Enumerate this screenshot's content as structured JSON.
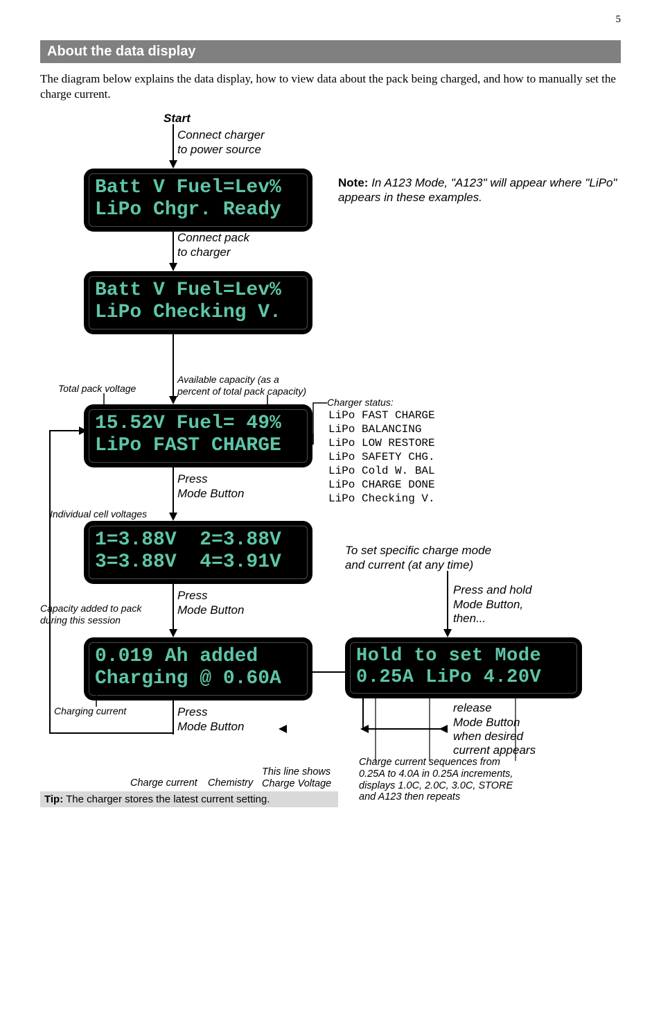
{
  "pageNumber": "5",
  "headerTitle": "About the data display",
  "introText": "The diagram below explains the data display, how to view data about the pack being charged, and how to manually set the charge current.",
  "startLabel": "Start",
  "connectCharger": "Connect charger\nto power source",
  "lcd1_line1": "Batt V Fuel=Lev%",
  "lcd1_line2": "LiPo Chgr. Ready",
  "noteBold": "Note:",
  "noteText": "In A123 Mode, \"A123\" will appear where \"LiPo\" appears in these examples.",
  "connectPack": "Connect pack\nto charger",
  "lcd2_line1": "Batt V Fuel=Lev%",
  "lcd2_line2": "LiPo Checking V.",
  "totalPackVoltage": "Total pack voltage",
  "availableCapacity": "Available capacity (as a\npercent of total pack capacity)",
  "lcd3_line1": "15.52V Fuel= 49%",
  "lcd3_line2": "LiPo FAST CHARGE",
  "chargerStatusLabel": "Charger status:",
  "statusList": "LiPo FAST CHARGE\nLiPo BALANCING\nLiPo LOW RESTORE\nLiPo SAFETY CHG.\nLiPo Cold W. BAL\nLiPo CHARGE DONE\nLiPo Checking V.",
  "pressMode": "Press\nMode Button",
  "individualCell": "Individual cell voltages",
  "lcd4_line1": "1=3.88V  2=3.88V",
  "lcd4_line2": "3=3.88V  4=3.91V",
  "toSetMode": "To set specific charge mode\nand current (at any time)",
  "capacityAdded": "Capacity added to pack\nduring this session",
  "pressHold": "Press and hold\nMode Button,\nthen...",
  "lcd5_line1": "0.019 Ah added",
  "lcd5_line2": "Charging @ 0.60A",
  "lcd6_line1": "Hold to set Mode",
  "lcd6_line2": "0.25A LiPo 4.20V",
  "chargingCurrent": "Charging current",
  "releaseMode": "release\nMode Button\nwhen desired\ncurrent appears",
  "chargeCurrentAnn": "Charge current",
  "chemistryAnn": "Chemistry",
  "thisLineShows": "This line shows\nCharge Voltage",
  "chargeSeq": "Charge current sequences from\n0.25A to 4.0A in 0.25A increments,\ndisplays 1.0C, 2.0C, 3.0C, STORE\nand A123 then repeats",
  "tipBold": "Tip:",
  "tipText": "The charger stores the latest current setting."
}
